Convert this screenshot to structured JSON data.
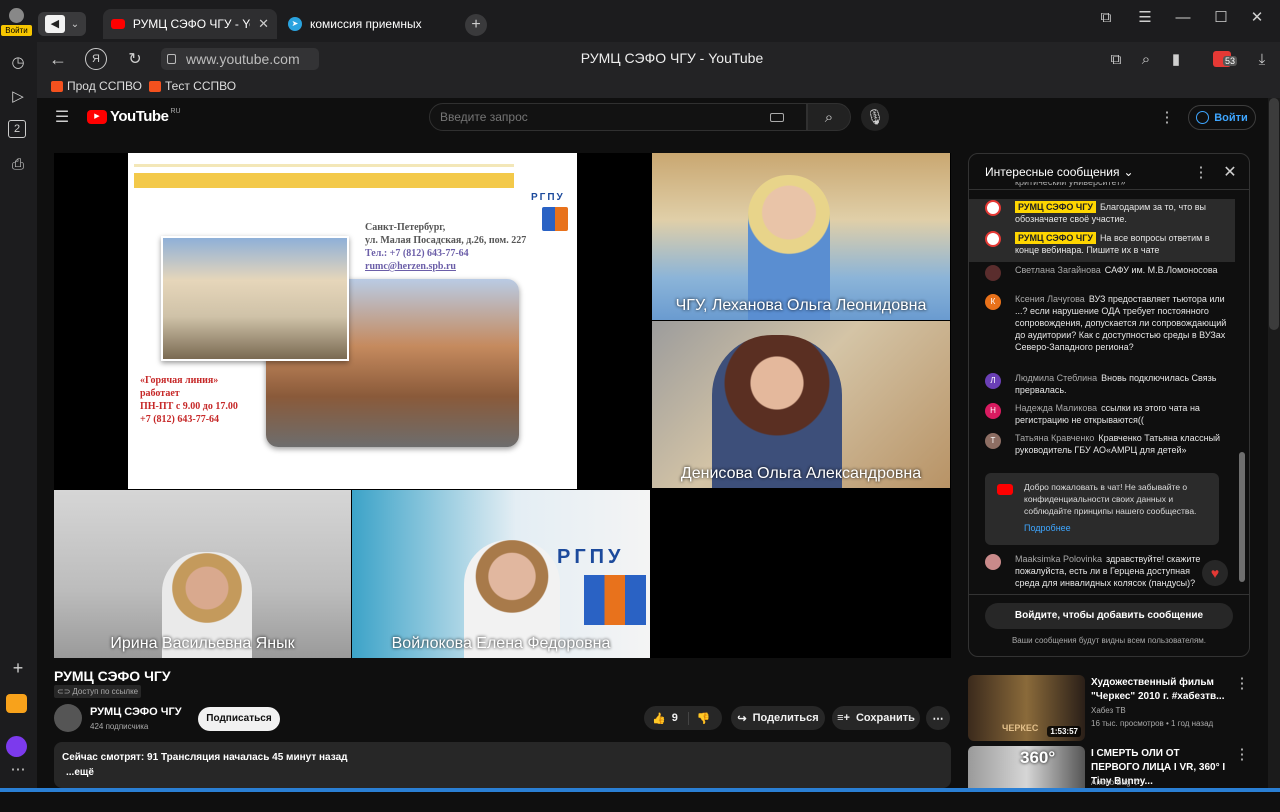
{
  "browser": {
    "login_label": "Войти",
    "tabs": [
      {
        "label": "РУМЦ СЭФО ЧГУ - YouTube"
      },
      {
        "label": "комиссия приемных"
      }
    ],
    "address": "www.youtube.com",
    "page_title": "РУМЦ СЭФО ЧГУ - YouTube",
    "bookmarks": [
      {
        "label": "Прод ССПВО"
      },
      {
        "label": "Тест ССПВО"
      }
    ],
    "sidebar_badge": "2",
    "notification_count": "53"
  },
  "youtube": {
    "logo": "YouTube",
    "logo_region": "RU",
    "search_placeholder": "Введите запрос",
    "signin_label": "Войти",
    "video": {
      "title": "РУМЦ СЭФО ЧГУ",
      "access": "Доступ по ссылке",
      "channel_name": "РУМЦ СЭФО ЧГУ",
      "subscribers": "424 подписчика",
      "subscribe_label": "Подписаться",
      "likes": "9",
      "share_label": "Поделиться",
      "save_label": "Сохранить",
      "desc_line1": "Сейчас смотрят: 91  Трансляция началась 45 минут назад",
      "desc_more": "...ещё",
      "slide": {
        "logo_text": "РГПУ",
        "address_lines": [
          "Санкт-Петербург,",
          "ул. Малая Посадская, д.26, пом. 227",
          "Тел.: +7 (812) 643-77-64",
          "rumc@herzen.spb.ru"
        ],
        "hotline_lines": [
          "«Горячая линия»",
          "работает",
          "ПН-ПТ с 9.00 до 17.00",
          "+7 (812) 643-77-64"
        ]
      },
      "participants": [
        {
          "name": "ЧГУ, Леханова Ольга Леонидовна"
        },
        {
          "name": "Денисова Ольга Александровна"
        },
        {
          "name": "Ирина Васильевна Янык"
        },
        {
          "name": "Войлокова Елена Федоровна"
        }
      ],
      "room_banner_text": "РГПУ"
    },
    "chat": {
      "title": "Интересные сообщения",
      "top_fragment": "критический университет»",
      "messages": [
        {
          "author": "РУМЦ СЭФО ЧГУ",
          "badge": true,
          "text": "Благодарим за то, что вы обозначаете своё участие.",
          "avatar": "",
          "color": "#fff"
        },
        {
          "author": "РУМЦ СЭФО ЧГУ",
          "badge": true,
          "text": "На все вопросы ответим в конце вебинара. Пишите их в чате",
          "avatar": "",
          "color": "#fff"
        },
        {
          "author": "Светлана Загайнова",
          "badge": false,
          "text": "САФУ им. М.В.Ломоносова",
          "avatar": "",
          "color": "#5a2d2d"
        },
        {
          "author": "Ксения Лачугова",
          "badge": false,
          "text": "ВУЗ предоставляет тьютора или ...? если нарушение ОДА требует постоянного сопровождения, допускается ли сопровождающий до аудитории? Как с доступностью среды в ВУЗах Северо-Западного региона?",
          "avatar": "К",
          "color": "#e8711a"
        },
        {
          "author": "Людмила Стеблина",
          "badge": false,
          "text": "Вновь подключилась Связь прервалась.",
          "avatar": "Л",
          "color": "#6a3fb5"
        },
        {
          "author": "Надежда Маликова",
          "badge": false,
          "text": "ссылки из этого чата на регистрацию не открываются((",
          "avatar": "Н",
          "color": "#d81b60"
        },
        {
          "author": "Татьяна Кравченко",
          "badge": false,
          "text": "Кравченко Татьяна классный руководитель ГБУ АО«АМРЦ для детей»",
          "avatar": "Т",
          "color": "#8d6e63"
        },
        {
          "author": "Maaksimka Polovinka",
          "badge": false,
          "text": "здравствуйте! скажите пожалуйста, есть ли в Герцена доступная среда для инвалидных колясок (пандусы)?",
          "avatar": "",
          "color": "#c98a8a"
        }
      ],
      "welcome_text": "Добро пожаловать в чат! Не забывайте о конфиденциальности своих данных и соблюдайте принципы нашего сообщества.",
      "welcome_link": "Подробнее",
      "signin_button": "Войдите, чтобы добавить сообщение",
      "footer_note": "Ваши сообщения будут видны всем пользователям."
    },
    "recommended": [
      {
        "title": "Художественный фильм \"Черкес\" 2010 г. #хабезтв...",
        "channel": "Хабез ТВ",
        "meta": "16 тыс. просмотров  •  1 год назад",
        "duration": "1:53:57",
        "thumb_text": "ЧЕРКЕС"
      },
      {
        "title": "I СМЕРТЬ ОЛИ ОТ ПЕРВОГО ЛИЦА I VR, 360° I Tiny Bunny...",
        "channel": "Ammo Bag ツ",
        "meta": "",
        "duration": "",
        "thumb_text": "360°"
      }
    ]
  },
  "colors": {
    "yt_red": "#ff0000",
    "bg": "#0f0f0f",
    "chat_bg": "#212121",
    "accent_blue": "#3ea6ff"
  }
}
